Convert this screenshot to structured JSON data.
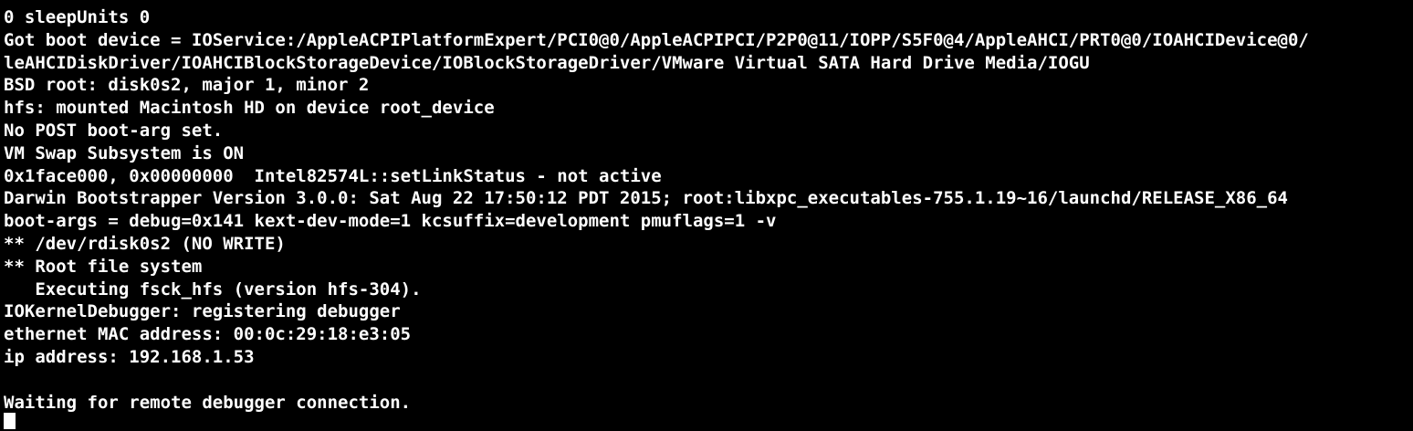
{
  "console": {
    "lines": [
      "0 sleepUnits 0",
      "Got boot device = IOService:/AppleACPIPlatformExpert/PCI0@0/AppleACPIPCI/P2P0@11/IOPP/S5F0@4/AppleAHCI/PRT0@0/IOAHCIDevice@0/",
      "leAHCIDiskDriver/IOAHCIBlockStorageDevice/IOBlockStorageDriver/VMware Virtual SATA Hard Drive Media/IOGU",
      "BSD root: disk0s2, major 1, minor 2",
      "hfs: mounted Macintosh HD on device root_device",
      "No POST boot-arg set.",
      "VM Swap Subsystem is ON",
      "0x1face000, 0x00000000  Intel82574L::setLinkStatus - not active",
      "Darwin Bootstrapper Version 3.0.0: Sat Aug 22 17:50:12 PDT 2015; root:libxpc_executables-755.1.19~16/launchd/RELEASE_X86_64",
      "boot-args = debug=0x141 kext-dev-mode=1 kcsuffix=development pmuflags=1 -v",
      "** /dev/rdisk0s2 (NO WRITE)",
      "** Root file system",
      "   Executing fsck_hfs (version hfs-304).",
      "IOKernelDebugger: registering debugger",
      "ethernet MAC address: 00:0c:29:18:e3:05",
      "ip address: 192.168.1.53",
      "",
      "Waiting for remote debugger connection."
    ]
  },
  "colors": {
    "background": "#000000",
    "text": "#ffffff"
  }
}
